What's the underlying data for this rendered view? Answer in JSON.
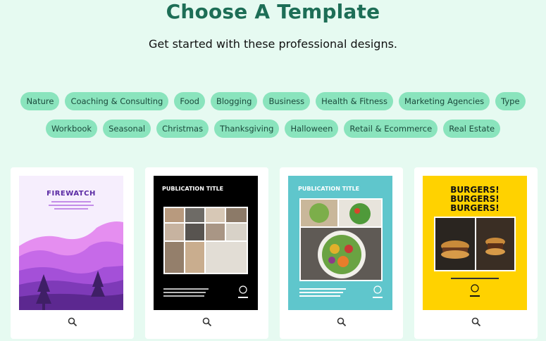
{
  "header": {
    "title": "Choose A Template",
    "subtitle": "Get started with these professional designs."
  },
  "tags_row1": [
    "Nature",
    "Coaching & Consulting",
    "Food",
    "Blogging",
    "Business",
    "Health & Fitness",
    "Marketing Agencies",
    "Type"
  ],
  "tags_row2": [
    "Workbook",
    "Seasonal",
    "Christmas",
    "Thanksgiving",
    "Halloween",
    "Retail & Ecommerce",
    "Real Estate"
  ],
  "templates": {
    "t1": {
      "title": "FIREWATCH"
    },
    "t2": {
      "title": "PUBLICATION TITLE"
    },
    "t3": {
      "title": "PUBLICATION TITLE"
    },
    "t4": {
      "title": "BURGERS! BURGERS! BURGERS!"
    }
  },
  "colors": {
    "background": "#e6faf1",
    "accent": "#1d6e56",
    "tag": "#8ae4bd"
  },
  "icons": {
    "preview": "magnifier-icon"
  }
}
